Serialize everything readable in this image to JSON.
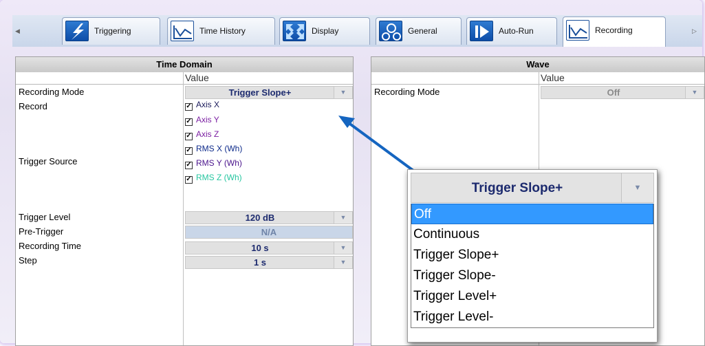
{
  "tabs": [
    {
      "label": "Triggering",
      "icon": "lightning-icon"
    },
    {
      "label": "Time History",
      "icon": "chart-icon"
    },
    {
      "label": "Display",
      "icon": "expand-icon"
    },
    {
      "label": "General",
      "icon": "gears-icon"
    },
    {
      "label": "Auto-Run",
      "icon": "play-icon"
    },
    {
      "label": "Recording",
      "icon": "chart-icon",
      "active": true
    }
  ],
  "left_panel": {
    "title": "Time Domain",
    "value_header": "Value",
    "recording_mode": {
      "label": "Recording Mode",
      "value": "Trigger Slope+"
    },
    "record_label": "Record",
    "trigger_source_label": "Trigger Source",
    "checkboxes": [
      {
        "label": "Axis X",
        "checked": true,
        "color": "#1a1a5a"
      },
      {
        "label": "Axis Y",
        "checked": true,
        "color": "#7b1fa2"
      },
      {
        "label": "Axis Z",
        "checked": true,
        "color": "#7b1fa2"
      },
      {
        "label": "RMS X (Wh)",
        "checked": true,
        "color": "#0d2a8a"
      },
      {
        "label": "RMS Y (Wh)",
        "checked": true,
        "color": "#4a148c"
      },
      {
        "label": "RMS Z (Wh)",
        "checked": true,
        "color": "#26c6a0"
      }
    ],
    "trigger_level": {
      "label": "Trigger Level",
      "value": "120 dB"
    },
    "pre_trigger": {
      "label": "Pre-Trigger",
      "value": "N/A"
    },
    "recording_time": {
      "label": "Recording Time",
      "value": "10 s"
    },
    "step": {
      "label": "Step",
      "value": "1 s"
    }
  },
  "right_panel": {
    "title": "Wave",
    "value_header": "Value",
    "recording_mode": {
      "label": "Recording Mode",
      "value": "Off"
    }
  },
  "zoom_dropdown": {
    "selected": "Trigger Slope+",
    "options": [
      "Off",
      "Continuous",
      "Trigger Slope+",
      "Trigger Slope-",
      "Trigger Level+",
      "Trigger Level-"
    ],
    "highlighted": "Off"
  },
  "colors": {
    "accent": "#3399ff",
    "value_text": "#1c2a6e",
    "arrow": "#1565c0"
  }
}
